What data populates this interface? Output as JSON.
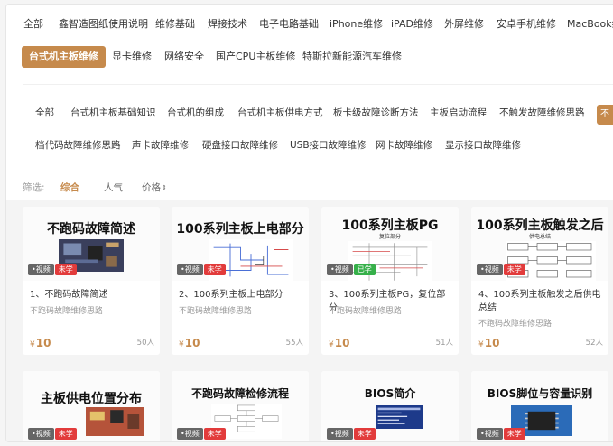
{
  "top_categories": [
    {
      "label": "全部",
      "active": false
    },
    {
      "label": "鑫智造图纸使用说明",
      "active": false
    },
    {
      "label": "维修基础",
      "active": false
    },
    {
      "label": "焊接技术",
      "active": false
    },
    {
      "label": "电子电路基础",
      "active": false
    },
    {
      "label": "iPhone维修",
      "active": false
    },
    {
      "label": "iPAD维修",
      "active": false
    },
    {
      "label": "外屏维修",
      "active": false
    },
    {
      "label": "安卓手机维修",
      "active": false
    },
    {
      "label": "MacBook维",
      "active": false
    },
    {
      "label": "台式机主板维修",
      "active": true
    },
    {
      "label": "显卡维修",
      "active": false
    },
    {
      "label": "网络安全",
      "active": false
    },
    {
      "label": "国产CPU主板维修",
      "active": false
    },
    {
      "label": "特斯拉新能源汽车维修",
      "active": false
    }
  ],
  "sub_categories": [
    "全部",
    "台式机主板基础知识",
    "台式机的组成",
    "台式机主板供电方式",
    "板卡级故障诊断方法",
    "主板启动流程",
    "不触发故障维修思路",
    "档代码故障维修思路",
    "声卡故障维修",
    "硬盘接口故障维修",
    "USB接口故障维修",
    "网卡故障维修",
    "显示接口故障维修"
  ],
  "sub_edge_label": "不",
  "filter": {
    "label": "筛选:",
    "options": [
      "综合",
      "人气",
      "价格"
    ],
    "price_sort_icon": "sort-updown-icon"
  },
  "colors": {
    "accent": "#c68a4c",
    "unlearned": "#e23b3b",
    "learned": "#36b04a"
  },
  "cards": [
    {
      "thumb_title": "不跑码故障简述",
      "thumb_sub": "",
      "type": "•视频",
      "status": "未学",
      "status_kind": "unlearned",
      "name": "1、不跑码故障简述",
      "category": "不跑码故障维修思路",
      "price_symbol": "¥",
      "price": "10",
      "count": "50人"
    },
    {
      "thumb_title": "100系列主板上电部分",
      "thumb_sub": "",
      "type": "•视频",
      "status": "未学",
      "status_kind": "unlearned",
      "name": "2、100系列主板上电部分",
      "category": "不跑码故障维修思路",
      "price_symbol": "¥",
      "price": "10",
      "count": "55人"
    },
    {
      "thumb_title": "100系列主板PG",
      "thumb_sub": "复位部分",
      "type": "•视频",
      "status": "已学",
      "status_kind": "learned",
      "name": "3、100系列主板PG，复位部分",
      "category": "不跑码故障维修思路",
      "price_symbol": "¥",
      "price": "10",
      "count": "51人"
    },
    {
      "thumb_title": "100系列主板触发之后",
      "thumb_sub": "供电总结",
      "type": "•视频",
      "status": "未学",
      "status_kind": "unlearned",
      "name": "4、100系列主板触发之后供电总结",
      "category": "不跑码故障维修思路",
      "price_symbol": "¥",
      "price": "10",
      "count": "52人"
    },
    {
      "thumb_title": "主板供电位置分布",
      "thumb_sub": "",
      "type": "•视频",
      "status": "未学",
      "status_kind": "unlearned"
    },
    {
      "thumb_title": "不跑码故障检修流程",
      "thumb_sub": "",
      "type": "•视频",
      "status": "未学",
      "status_kind": "unlearned"
    },
    {
      "thumb_title": "BIOS简介",
      "thumb_sub": "",
      "type": "•视频",
      "status": "未学",
      "status_kind": "unlearned"
    },
    {
      "thumb_title": "BIOS脚位与容量识别",
      "thumb_sub": "",
      "type": "•视频",
      "status": "未学",
      "status_kind": "unlearned"
    }
  ]
}
